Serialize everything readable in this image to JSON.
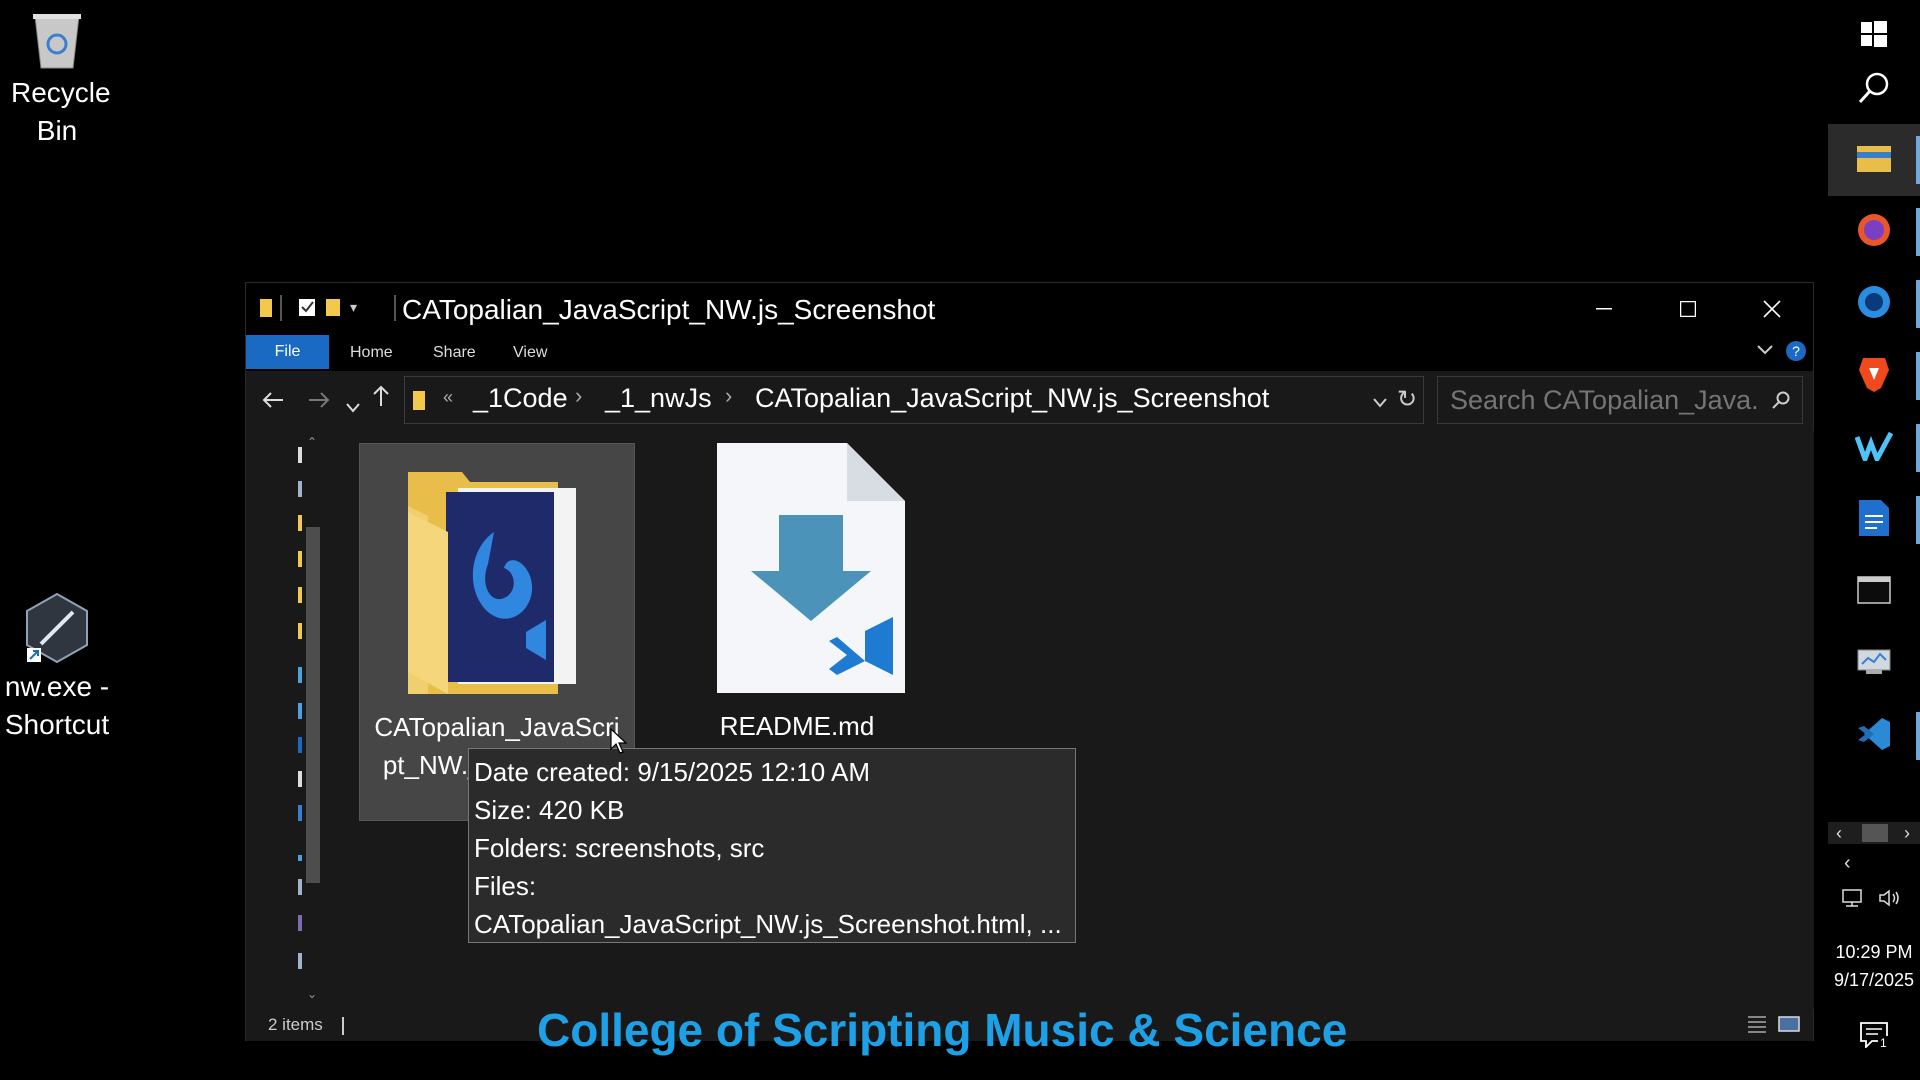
{
  "desktop": {
    "recycle_bin": {
      "label": "Recycle Bin"
    },
    "nw_shortcut": {
      "label": "nw.exe - Shortcut"
    }
  },
  "explorer": {
    "title": "CATopalian_JavaScript_NW.js_Screenshot",
    "ribbon_tabs": [
      "File",
      "Home",
      "Share",
      "View"
    ],
    "breadcrumb": {
      "overflow": "«",
      "items": [
        "_1Code",
        "_1_nwJs",
        "CATopalian_JavaScript_NW.js_Screenshot"
      ]
    },
    "search_placeholder": "Search CATopalian_Java...",
    "items": [
      {
        "label": "CATopalian_JavaScript_NW.js_Screenshot",
        "display_label": "CATopalian_JavaScri pt_NW.js_Screensh",
        "type": "folder",
        "selected": true
      },
      {
        "label": "README.md",
        "type": "markdown-file",
        "selected": false
      }
    ],
    "tooltip": {
      "date_created": "Date created: 9/15/2025 12:10 AM",
      "size": "Size: 420 KB",
      "folders": "Folders: screenshots, src",
      "files_label": "Files:",
      "files": "CATopalian_JavaScript_NW.js_Screenshot.html, ..."
    },
    "status": {
      "count": "2 items"
    }
  },
  "watermark": "College of Scripting Music & Science",
  "taskbar": {
    "apps": [
      "windows-start",
      "search",
      "file-explorer",
      "firefox",
      "firefox-developer",
      "brave",
      "windsurf",
      "libreoffice-writer",
      "terminal",
      "system-monitor",
      "vscode"
    ],
    "time": "10:29 PM",
    "date": "9/17/2025",
    "notifications": "1"
  },
  "colors": {
    "accent": "#1a6ac4",
    "watermark": "#1ea0e6",
    "window_bg": "#191919",
    "selection": "#464646"
  }
}
